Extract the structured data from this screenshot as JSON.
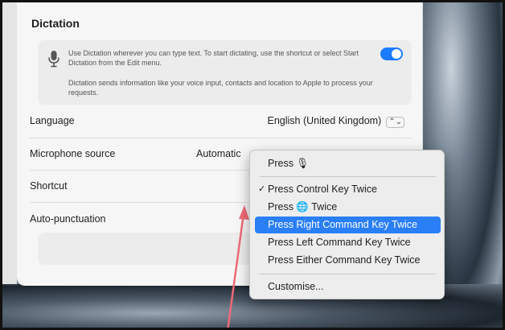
{
  "dictation": {
    "title": "Dictation",
    "info_text_1": "Use Dictation wherever you can type text. To start dictating, use the shortcut or select Start Dictation from the Edit menu.",
    "info_text_2": "Dictation sends information like your voice input, contacts and location to Apple to process your requests.",
    "toggle_on": true
  },
  "settings": {
    "language_label": "Language",
    "language_value": "English (United Kingdom)",
    "microphone_label": "Microphone source",
    "microphone_value": "Automatic",
    "shortcut_label": "Shortcut",
    "autopunct_label": "Auto-punctuation"
  },
  "shortcut_menu": {
    "items": [
      "Press 🎙",
      "Press Control Key Twice",
      "Press 🌐 Twice",
      "Press Right Command Key Twice",
      "Press Left Command Key Twice",
      "Press Either Command Key Twice",
      "Customise..."
    ],
    "checked_index": 1,
    "highlighted_index": 3,
    "check_mark": "✓"
  },
  "colors": {
    "accent": "#2a7ff6",
    "annotation_arrow": "#f06a78"
  }
}
